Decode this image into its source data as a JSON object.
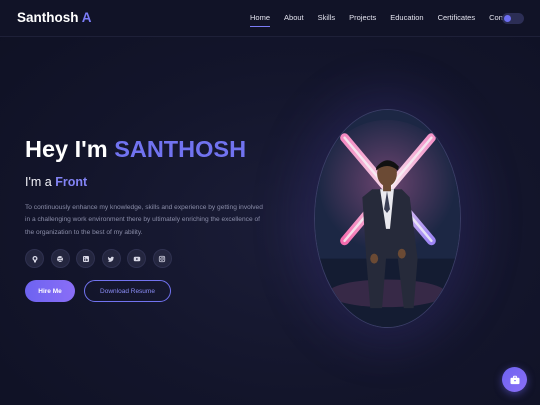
{
  "brand": {
    "name": "Santhosh",
    "accent": "A"
  },
  "nav": {
    "items": [
      {
        "label": "Home",
        "active": true
      },
      {
        "label": "About"
      },
      {
        "label": "Skills"
      },
      {
        "label": "Projects"
      },
      {
        "label": "Education"
      },
      {
        "label": "Certificates"
      },
      {
        "label": "Contact"
      }
    ],
    "theme_toggle": {
      "icon": "toggle-icon"
    }
  },
  "hero": {
    "greeting": "Hey I'm",
    "name": "SANTHOSH",
    "role_prefix": "I'm a",
    "role_typed": "Front",
    "description": "To continuously enhance my knowledge, skills and experience by getting involved in a challenging work environment there by ultimately enriching the excellence of the organization to the best of my ability.",
    "socials": [
      {
        "icon": "github-icon"
      },
      {
        "icon": "dribbble-icon"
      },
      {
        "icon": "linkedin-icon"
      },
      {
        "icon": "twitter-icon"
      },
      {
        "icon": "youtube-icon"
      },
      {
        "icon": "instagram-icon"
      }
    ],
    "hire_label": "Hire Me",
    "resume_label": "Download Resume"
  },
  "colors": {
    "accent": "#7173f0",
    "background": "#13152b",
    "text": "#ffffff",
    "muted": "#8a8da8"
  },
  "fab": {
    "icon": "briefcase-icon"
  }
}
